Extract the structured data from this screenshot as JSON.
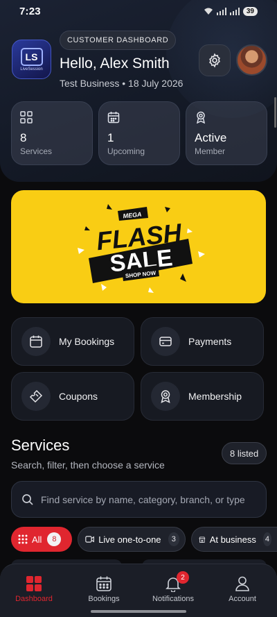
{
  "status_bar": {
    "time": "7:23",
    "battery": "39"
  },
  "header": {
    "logo_text": "LiveSession",
    "logo_mark": "LS",
    "dashboard_pill": "CUSTOMER DASHBOARD",
    "greeting": "Hello, Alex Smith",
    "subline": "Test Business • 18 July 2026"
  },
  "stats": [
    {
      "value": "8",
      "label": "Services",
      "icon": "grid-icon"
    },
    {
      "value": "1",
      "label": "Upcoming",
      "icon": "calendar-icon"
    },
    {
      "value": "Active",
      "label": "Member",
      "icon": "award-icon"
    }
  ],
  "banner": {
    "top": "MEGA",
    "line1": "FLASH",
    "line2": "SALE",
    "cta": "SHOP NOW",
    "color": "#f9cd14"
  },
  "quick_actions": [
    {
      "label": "My Bookings",
      "icon": "calendar-icon"
    },
    {
      "label": "Payments",
      "icon": "card-icon"
    },
    {
      "label": "Coupons",
      "icon": "ticket-icon"
    },
    {
      "label": "Membership",
      "icon": "award-icon"
    }
  ],
  "services": {
    "title": "Services",
    "subtitle": "Search, filter, then choose a service",
    "listed": "8 listed",
    "search_placeholder": "Find service by name, category, branch, or type"
  },
  "filters": [
    {
      "label": "All",
      "count": "8",
      "active": true
    },
    {
      "label": "Live one-to-one",
      "count": "3",
      "active": false
    },
    {
      "label": "At business",
      "count": "4",
      "active": false
    }
  ],
  "nav": [
    {
      "label": "Dashboard",
      "active": true
    },
    {
      "label": "Bookings",
      "active": false
    },
    {
      "label": "Notifications",
      "badge": "2",
      "active": false
    },
    {
      "label": "Account",
      "active": false
    }
  ],
  "colors": {
    "accent": "#e0262f",
    "background": "#0b0b0d",
    "banner": "#f9cd14"
  }
}
